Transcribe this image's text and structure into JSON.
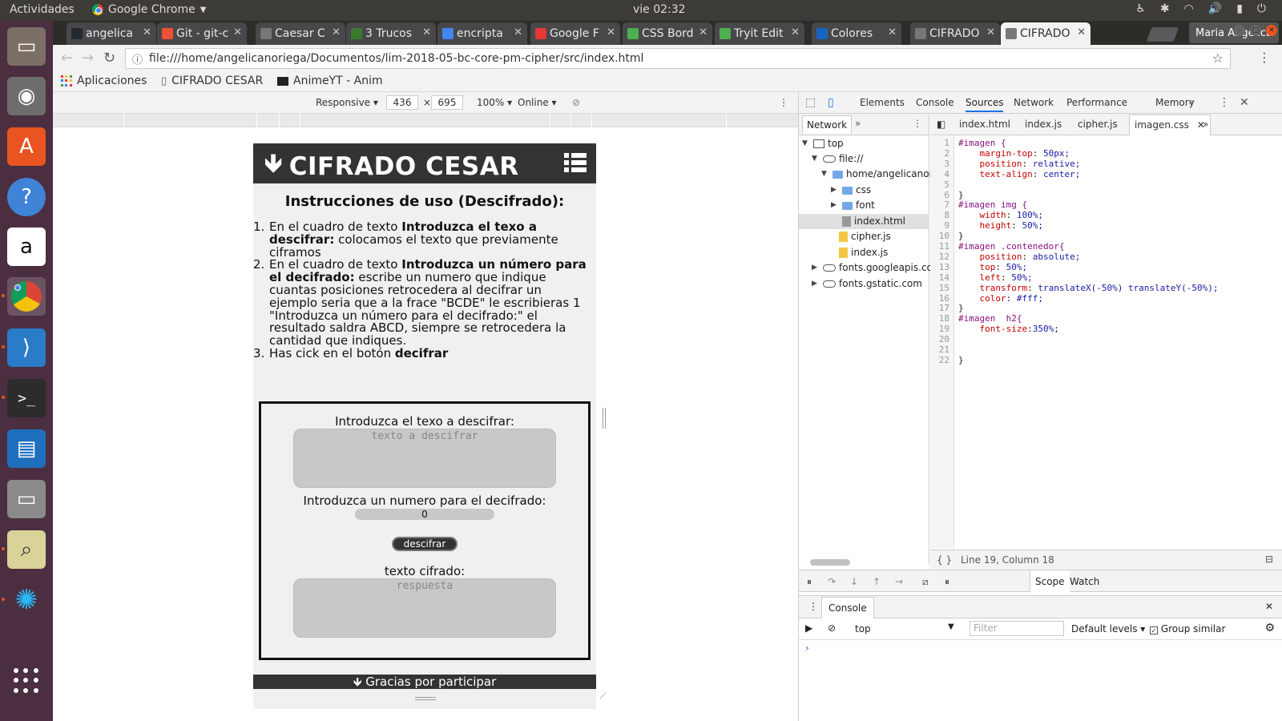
{
  "os": {
    "activities": "Actividades",
    "app_name": "Google Chrome",
    "clock": "vie 02:32"
  },
  "tabs": [
    {
      "label": "angelica",
      "icon_color": "#24292e",
      "icon": "github-icon"
    },
    {
      "label": "Git - git-c",
      "icon_color": "#f05033",
      "icon": "git-icon"
    },
    {
      "label": "Caesar C",
      "icon_color": "#777777",
      "icon": "page-icon"
    },
    {
      "label": "3 Trucos",
      "icon_color": "#3b7a2e",
      "icon": "blog-icon"
    },
    {
      "label": "encripta",
      "icon_color": "#4285f4",
      "icon": "google-icon"
    },
    {
      "label": "Google F",
      "icon_color": "#e53935",
      "icon": "google-fonts-icon"
    },
    {
      "label": "CSS Bord",
      "icon_color": "#4caf50",
      "icon": "w3schools-icon"
    },
    {
      "label": "Tryit Edit",
      "icon_color": "#4caf50",
      "icon": "w3schools-icon"
    },
    {
      "label": "Colores",
      "icon_color": "#1565c0",
      "icon": "colors-icon"
    },
    {
      "label": "CIFRADO",
      "icon_color": "#777777",
      "icon": "page-icon"
    },
    {
      "label": "CIFRADO",
      "icon_color": "#777777",
      "icon": "page-icon",
      "active": true
    }
  ],
  "user": "Maria Angelica",
  "url": "file:///home/angelicanoriega/Documentos/lim-2018-05-bc-core-pm-cipher/src/index.html",
  "bookmarks": [
    "Aplicaciones",
    "CIFRADO CESAR",
    "AnimeYT - Anim"
  ],
  "device_toolbar": {
    "mode": "Responsive",
    "width": "436",
    "height": "695",
    "zoom": "100%",
    "network": "Online"
  },
  "page": {
    "header": "CIFRADO CESAR",
    "instr_title": "Instrucciones de uso (Descifrado):",
    "steps": [
      {
        "num": "1.",
        "pre": "En el cuadro de texto ",
        "bold": "Introduzca el texo a descifrar:",
        "post": " colocamos el texto que previamente ciframos"
      },
      {
        "num": "2.",
        "pre": "En el cuadro de texto ",
        "bold": "Introduzca un número para el decifrado:",
        "post": " escribe un numero que indique cuantas posiciones retrocedera al decifrar un ejemplo seria que a la frace \"BCDE\" le escribieras 1 \"Introduzca un número para el decifrado:\" el resultado saldra ABCD, siempre se retrocedera la cantidad que indiques."
      },
      {
        "num": "3.",
        "pre": "Has cick en el botón ",
        "bold": "decifrar",
        "post": ""
      }
    ],
    "label_text": "Introduzca el texo a descifrar:",
    "placeholder_text": "texto a descifrar",
    "label_number": "Introduzca un numero para el decifrado:",
    "number_value": "0",
    "button": "descifrar",
    "label_result": "texto cifrado:",
    "placeholder_result": "respuesta",
    "footer": "Gracias por participar"
  },
  "devtools": {
    "tabs": [
      "Elements",
      "Console",
      "Sources",
      "Network",
      "Performance",
      "Memory"
    ],
    "active_tab": "Sources",
    "navigator_tab": "Network",
    "tree": [
      "top",
      "file://",
      "home/angelicanorie",
      "css",
      "font",
      "index.html",
      "cipher.js",
      "index.js",
      "fonts.googleapis.com",
      "fonts.gstatic.com"
    ],
    "editor_tabs": [
      "index.html",
      "index.js",
      "cipher.js",
      "imagen.css"
    ],
    "active_editor_tab": "imagen.css",
    "code": [
      "#imagen {",
      "    margin-top: 50px;",
      "    position: relative;",
      "    text-align: center;",
      "",
      "}",
      "#imagen img {",
      "    width: 100%;",
      "    height: 50%;",
      "}",
      "#imagen .contenedor{",
      "    position: absolute;",
      "    top: 50%;",
      "    left: 50%;",
      "    transform: translateX(-50%) translateY(-50%);",
      "    color: #fff;",
      "}",
      "#imagen  h2{",
      "    font-size:350%;",
      "",
      "",
      "}"
    ],
    "cursor_status": "Line 19, Column 18",
    "scope": "Scope",
    "watch": "Watch",
    "console_title": "Console",
    "context": "top",
    "filter_placeholder": "Filter",
    "levels": "Default levels",
    "group_similar": "Group similar"
  }
}
